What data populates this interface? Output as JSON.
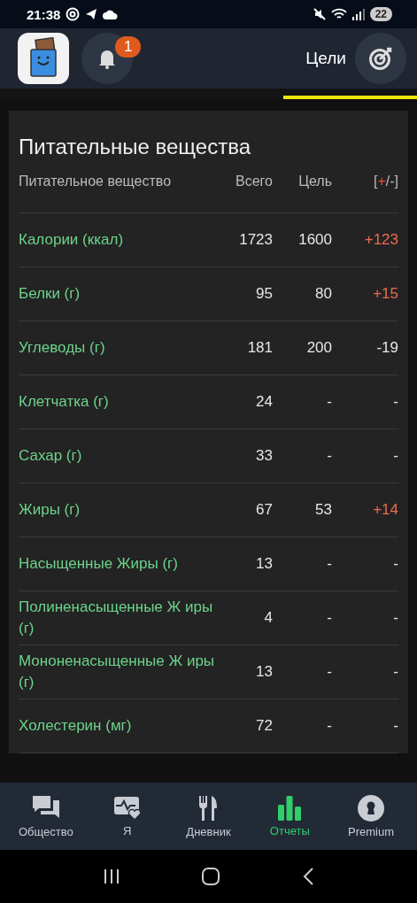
{
  "status_bar": {
    "time": "21:38",
    "battery": "22"
  },
  "header": {
    "notification_count": "1",
    "goals_label": "Цели",
    "progress": {
      "level": 0.32
    }
  },
  "card": {
    "title": "Питательные вещества",
    "columns": [
      {
        "label": "Питательное вещество"
      },
      {
        "label": "Всего"
      },
      {
        "label": "Цель"
      },
      {
        "label": "[**+**/-]"
      }
    ],
    "rows": [
      {
        "name": "Калории (ккал)",
        "total": "1723",
        "goal": "1600",
        "diff": "+123",
        "over": true
      },
      {
        "name": "Белки (г)",
        "total": "95",
        "goal": "80",
        "diff": "+15",
        "over": true
      },
      {
        "name": "Углеводы (г)",
        "total": "181",
        "goal": "200",
        "diff": "-19",
        "over": false
      },
      {
        "name": "Клетчатка (г)",
        "total": "24",
        "goal": "-",
        "diff": "-",
        "over": false
      },
      {
        "name": "Сахар (г)",
        "total": "33",
        "goal": "-",
        "diff": "-",
        "over": false
      },
      {
        "name": "Жиры (г)",
        "total": "67",
        "goal": "53",
        "diff": "+14",
        "over": true
      },
      {
        "name": "Насыщенные Жиры (г)",
        "total": "13",
        "goal": "-",
        "diff": "-",
        "over": false
      },
      {
        "name": "Полиненасыщенные Ж иры (г)",
        "total": "4",
        "goal": "-",
        "diff": "-",
        "over": false
      },
      {
        "name": "Мононенасыщенные Ж иры (г)",
        "total": "13",
        "goal": "-",
        "diff": "-",
        "over": false
      },
      {
        "name": "Холестерин (мг)",
        "total": "72",
        "goal": "-",
        "diff": "-",
        "over": false
      }
    ]
  },
  "nav": [
    {
      "label": "Общество",
      "kind": "chat",
      "selected": false
    },
    {
      "label": "Я",
      "kind": "health",
      "selected": false
    },
    {
      "label": "Дневник",
      "kind": "food",
      "selected": false
    },
    {
      "label": "Отчеты",
      "kind": "chart",
      "selected": true
    },
    {
      "label": "Premium",
      "kind": "lock",
      "selected": false
    }
  ]
}
